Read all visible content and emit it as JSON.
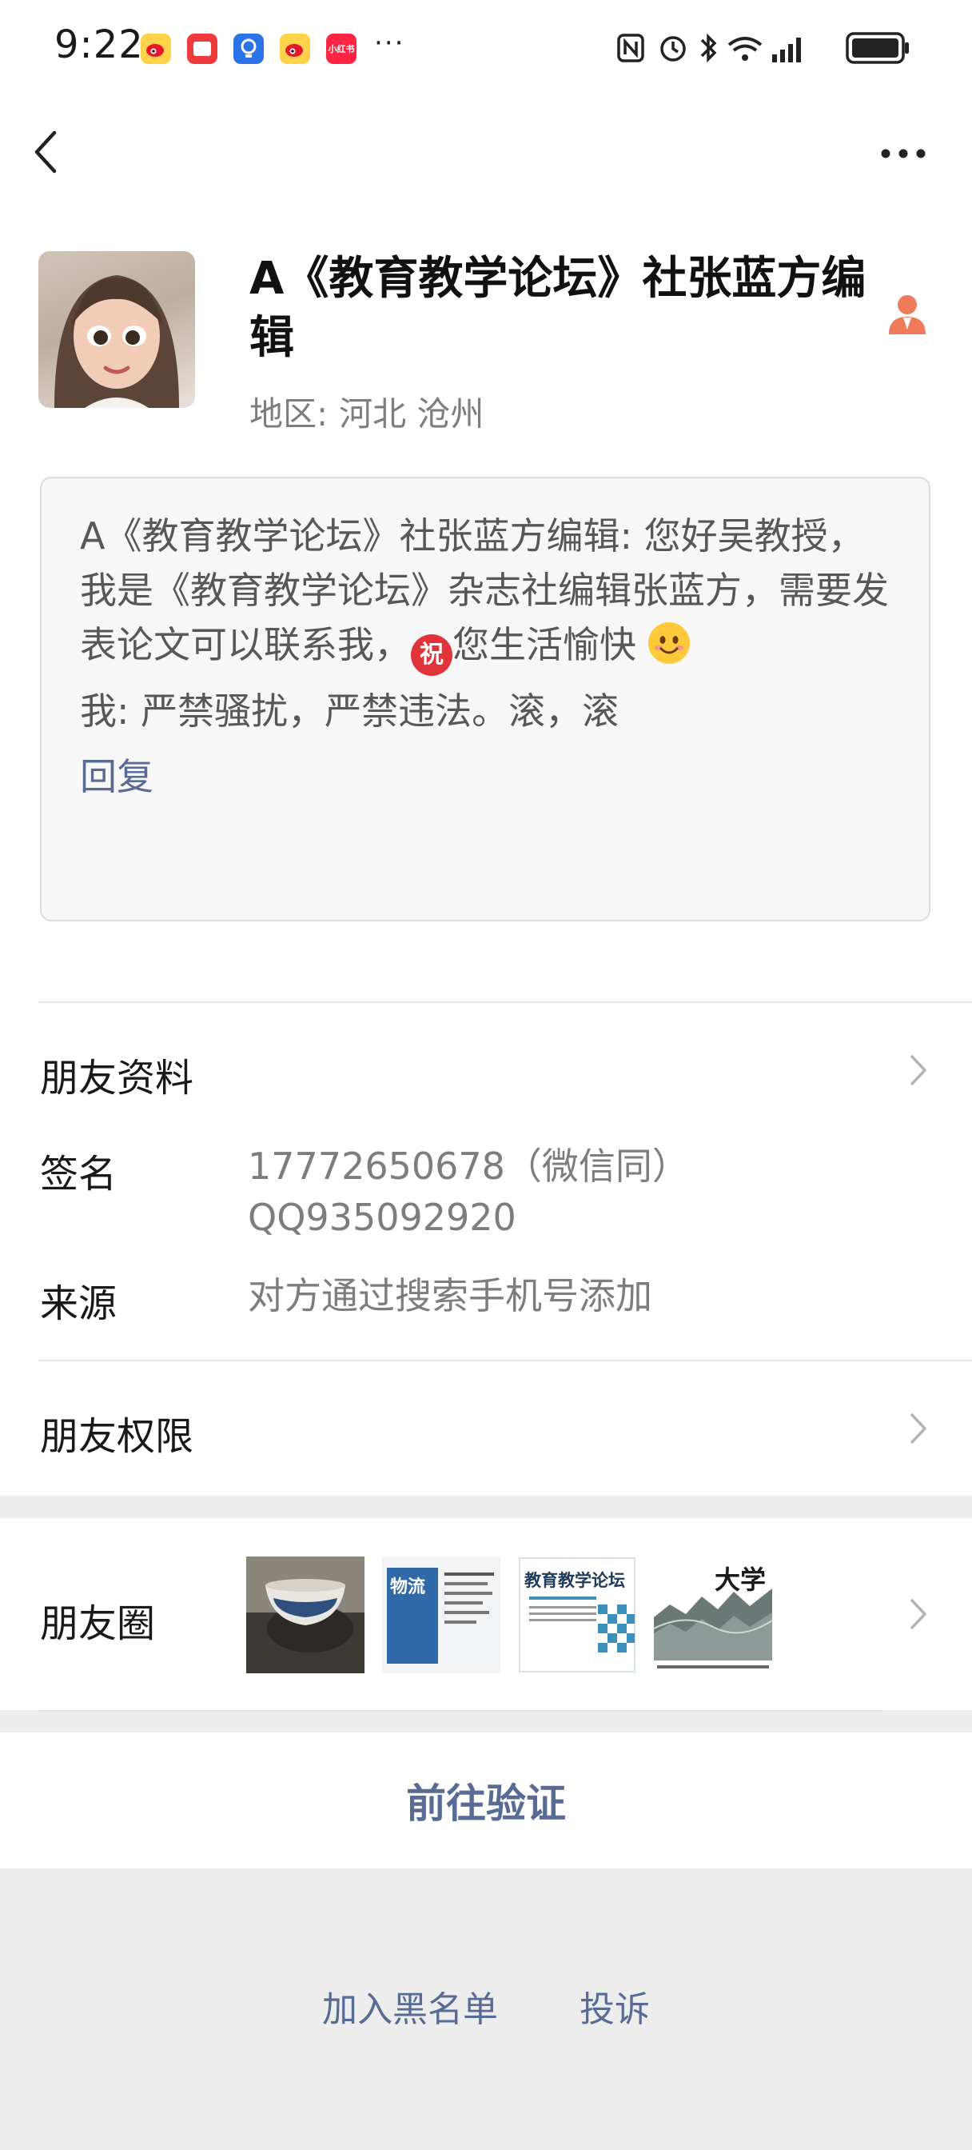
{
  "status_bar": {
    "time": "9:22",
    "app_badge_label": "小红书",
    "more": "···"
  },
  "profile": {
    "nickname": "A《教育教学论坛》社张蓝方编辑",
    "region_label": "地区:",
    "region_value": "河北  沧州"
  },
  "message": {
    "text": "A《教育教学论坛》社张蓝方编辑: 您好吴教授，我是《教育教学论坛》杂志社编辑张蓝方，需要发表论文可以联系我，",
    "zhu_emoji": "祝",
    "text_after": "您生活愉快",
    "my_reply": "我: 严禁骚扰，严禁违法。滚，滚",
    "reply_button": "回复"
  },
  "info": {
    "friend_profile": "朋友资料",
    "signature_label": "签名",
    "signature_line1": "17772650678（微信同）",
    "signature_line2": "QQ935092920",
    "source_label": "来源",
    "source_value": "对方通过搜索手机号添加",
    "permissions": "朋友权限",
    "moments": "朋友圈"
  },
  "thumbnails": {
    "thumb2_title": "物流",
    "thumb3_title": "教育教学论坛",
    "thumb4_title": "大学"
  },
  "actions": {
    "verify": "前往验证",
    "blacklist": "加入黑名单",
    "report": "投诉"
  },
  "colors": {
    "link_blue": "#576b95",
    "bg_gray": "#ededed"
  }
}
